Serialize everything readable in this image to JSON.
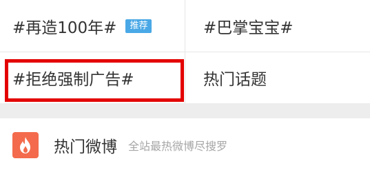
{
  "topics": {
    "items": [
      {
        "label": "#再造100年#",
        "badge": "推荐"
      },
      {
        "label": "#巴掌宝宝#"
      },
      {
        "label": "#拒绝强制广告#"
      },
      {
        "label": "热门话题"
      }
    ]
  },
  "hot_weibo": {
    "icon": "flame-icon",
    "title": "热门微博",
    "subtitle": "全站最热微博尽搜罗"
  },
  "colors": {
    "badge": "#4aa8e6",
    "highlight_border": "#e30000",
    "flame_bg": "#f36b4c"
  }
}
